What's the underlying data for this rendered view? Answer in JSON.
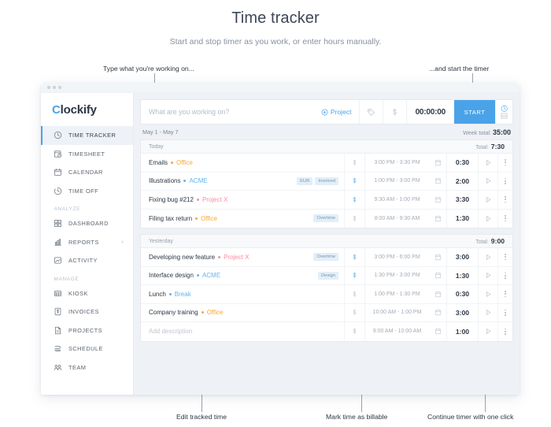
{
  "header": {
    "title": "Time tracker",
    "subtitle": "Start and stop timer as you work, or enter hours manually."
  },
  "annotations": {
    "top_left": "Type what you're working on...",
    "top_right": "...and start the timer",
    "bottom_left": "Edit tracked time",
    "bottom_mid": "Mark time as billable",
    "bottom_right": "Continue timer with one click"
  },
  "app": {
    "logo": {
      "accent_letter": "C",
      "rest": "lockify",
      "accent_color": "#4aa3e8"
    },
    "sidebar": {
      "items": [
        {
          "label": "TIME TRACKER",
          "icon": "clock-icon",
          "active": true
        },
        {
          "label": "TIMESHEET",
          "icon": "timesheet-icon",
          "active": false
        },
        {
          "label": "CALENDAR",
          "icon": "calendar-icon",
          "active": false
        },
        {
          "label": "TIME OFF",
          "icon": "time-off-icon",
          "active": false
        }
      ],
      "group_analyze": "ANALYZE",
      "analyze_items": [
        {
          "label": "DASHBOARD",
          "icon": "dashboard-icon",
          "chevron": ""
        },
        {
          "label": "REPORTS",
          "icon": "reports-icon",
          "chevron": "›"
        },
        {
          "label": "ACTIVITY",
          "icon": "activity-icon",
          "chevron": ""
        }
      ],
      "group_manage": "MANAGE",
      "manage_items": [
        {
          "label": "KIOSK",
          "icon": "kiosk-icon"
        },
        {
          "label": "INVOICES",
          "icon": "invoices-icon"
        },
        {
          "label": "PROJECTS",
          "icon": "projects-icon"
        },
        {
          "label": "SCHEDULE",
          "icon": "schedule-icon"
        },
        {
          "label": "TEAM",
          "icon": "team-icon"
        }
      ]
    },
    "timer_bar": {
      "placeholder": "What are you working on?",
      "value": "",
      "project_label": "Project",
      "tag_icon": "tag-icon",
      "billable_icon": "dollar-icon",
      "elapsed": "00:00:00",
      "start_label": "START",
      "mode_timer_icon": "clock-icon",
      "mode_manual_icon": "list-icon"
    },
    "week": {
      "range": "May 1 - May 7",
      "total_label": "Week total:",
      "total": "35:00"
    },
    "days": [
      {
        "name": "Today",
        "total_label": "Total:",
        "total": "7:30",
        "entries": [
          {
            "description": "Emails",
            "project": "Office",
            "project_color": "#f3a93c",
            "tags": [],
            "billable": false,
            "range": "3:00 PM - 3:30 PM",
            "duration": "0:30"
          },
          {
            "description": "Illustrations",
            "project": "ACME",
            "project_color": "#62b4ef",
            "tags": [
              "EUR",
              "Invoiced"
            ],
            "billable": true,
            "range": "1:00 PM - 3:00 PM",
            "duration": "2:00"
          },
          {
            "description": "Fixing bug #212",
            "project": "Project X",
            "project_color": "#f48fa5",
            "tags": [],
            "billable": true,
            "range": "9:30 AM - 1:00 PM",
            "duration": "3:30"
          },
          {
            "description": "Filing tax return",
            "project": "Office",
            "project_color": "#f3a93c",
            "tags": [
              "Overtime"
            ],
            "billable": false,
            "range": "8:00 AM - 9:30 AM",
            "duration": "1:30"
          }
        ]
      },
      {
        "name": "Yesterday",
        "total_label": "Total:",
        "total": "9:00",
        "entries": [
          {
            "description": "Developing new feature",
            "project": "Project X",
            "project_color": "#f48fa5",
            "tags": [
              "Overtime"
            ],
            "billable": true,
            "range": "3:00 PM - 6:00 PM",
            "duration": "3:00"
          },
          {
            "description": "Interface design",
            "project": "ACME",
            "project_color": "#62b4ef",
            "tags": [
              "Design"
            ],
            "billable": true,
            "range": "1:30 PM - 3:00 PM",
            "duration": "1:30"
          },
          {
            "description": "Lunch",
            "project": "Break",
            "project_color": "#62b4ef",
            "tags": [],
            "billable": false,
            "range": "1:00 PM - 1:30 PM",
            "duration": "0:30"
          },
          {
            "description": "Company training",
            "project": "Office",
            "project_color": "#f3a93c",
            "tags": [],
            "billable": false,
            "range": "10:00 AM - 1:00 PM",
            "duration": "3:00"
          },
          {
            "description": "Add description",
            "description_is_placeholder": true,
            "project": "",
            "project_color": "",
            "tags": [],
            "billable": false,
            "range": "9:00 AM - 10:00 AM",
            "duration": "1:00"
          }
        ]
      }
    ]
  }
}
